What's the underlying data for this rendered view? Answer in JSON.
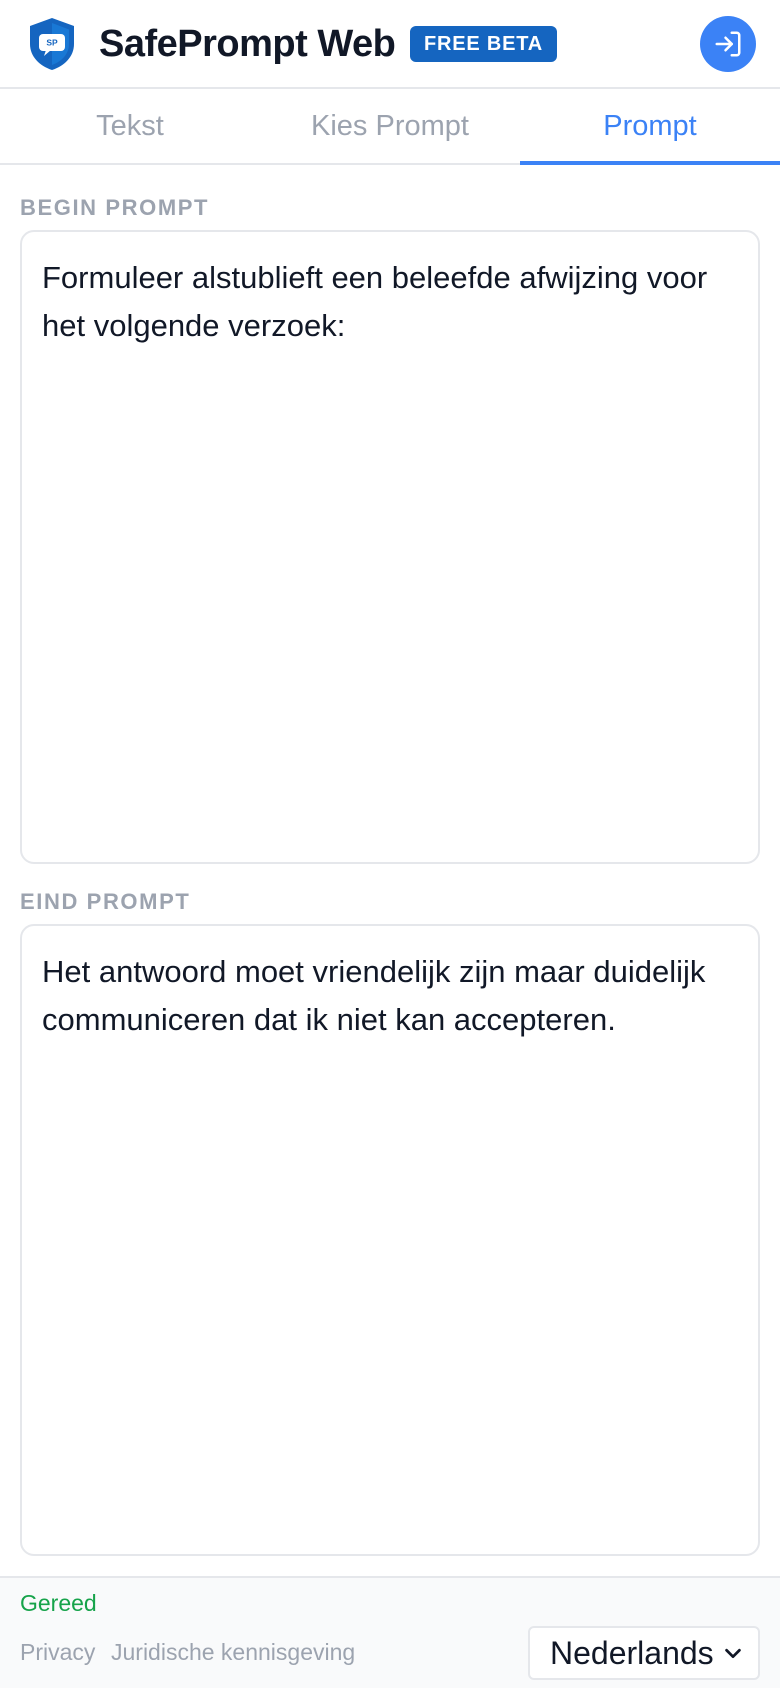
{
  "header": {
    "app_title": "SafePrompt Web",
    "badge": "FREE BETA",
    "logo_text": "SP",
    "login_icon": "login-icon"
  },
  "tabs": [
    {
      "label": "Tekst",
      "active": false
    },
    {
      "label": "Kies Prompt",
      "active": false
    },
    {
      "label": "Prompt",
      "active": true
    }
  ],
  "begin_prompt": {
    "label": "BEGIN PROMPT",
    "value": "Formuleer alstublieft een beleefde afwijzing voor het volgende verzoek:"
  },
  "end_prompt": {
    "label": "EIND PROMPT",
    "value": "Het antwoord moet vriendelijk zijn maar duidelijk communiceren dat ik niet kan accepteren."
  },
  "footer": {
    "status": "Gereed",
    "privacy": "Privacy",
    "legal": "Juridische kennisgeving",
    "language": "Nederlands"
  },
  "colors": {
    "accent": "#3b82f6",
    "badge": "#1565c0",
    "status_ok": "#16a34a",
    "muted": "#9ca3af"
  }
}
